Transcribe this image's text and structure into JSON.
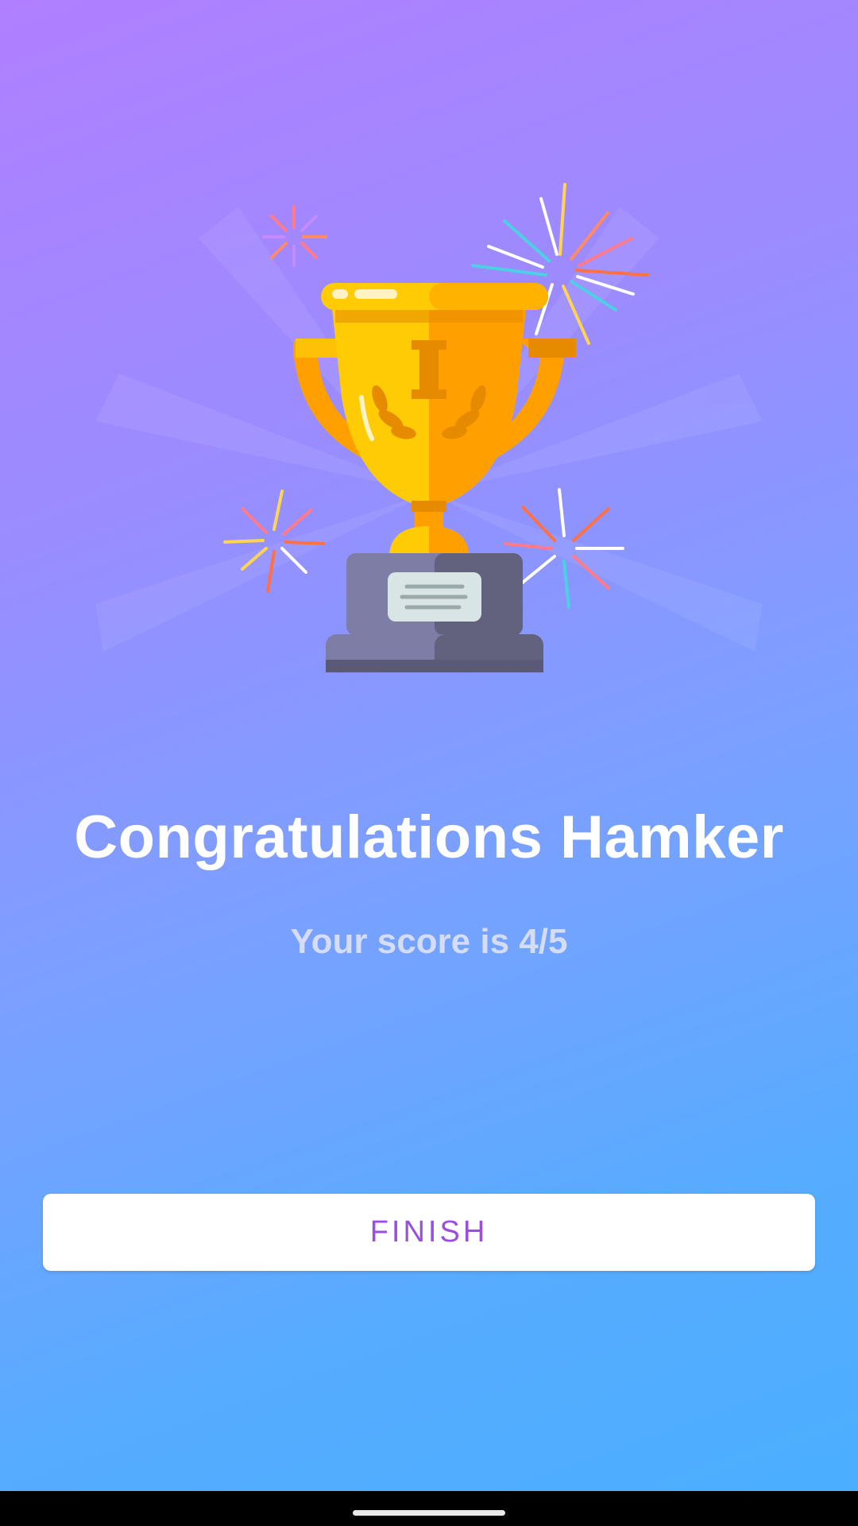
{
  "result": {
    "title": "Congratulations Hamker",
    "score_text": "Your score is 4/5"
  },
  "actions": {
    "finish_label": "FINISH"
  },
  "illustration": {
    "icon": "trophy-icon",
    "decorations": [
      "firework-icon"
    ]
  },
  "colors": {
    "gradient_top": "#b07fff",
    "gradient_bottom": "#4aaeff",
    "button_text": "#9a4fe0",
    "trophy_gold": "#ffc107",
    "trophy_orange": "#ffa000"
  }
}
